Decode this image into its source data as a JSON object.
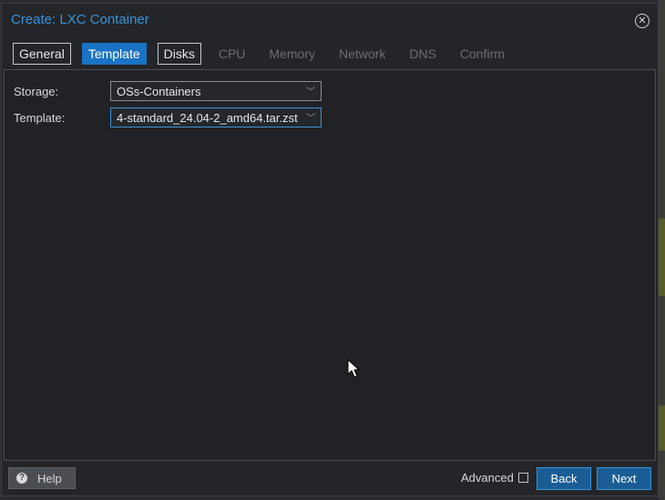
{
  "window": {
    "title": "Create: LXC Container"
  },
  "tabs": [
    {
      "label": "General",
      "state": "enabled"
    },
    {
      "label": "Template",
      "state": "active"
    },
    {
      "label": "Disks",
      "state": "enabled"
    },
    {
      "label": "CPU",
      "state": "disabled"
    },
    {
      "label": "Memory",
      "state": "disabled"
    },
    {
      "label": "Network",
      "state": "disabled"
    },
    {
      "label": "DNS",
      "state": "disabled"
    },
    {
      "label": "Confirm",
      "state": "disabled"
    }
  ],
  "form": {
    "storage": {
      "label": "Storage:",
      "value": "OSs-Containers"
    },
    "template": {
      "label": "Template:",
      "value": "4-standard_24.04-2_amd64.tar.zst"
    }
  },
  "footer": {
    "help_label": "Help",
    "advanced_label": "Advanced",
    "advanced_checked": false,
    "back_label": "Back",
    "next_label": "Next"
  },
  "colors": {
    "accent": "#3b93d8",
    "active_tab": "#1a73c5",
    "primary_button": "#1a5d94"
  }
}
